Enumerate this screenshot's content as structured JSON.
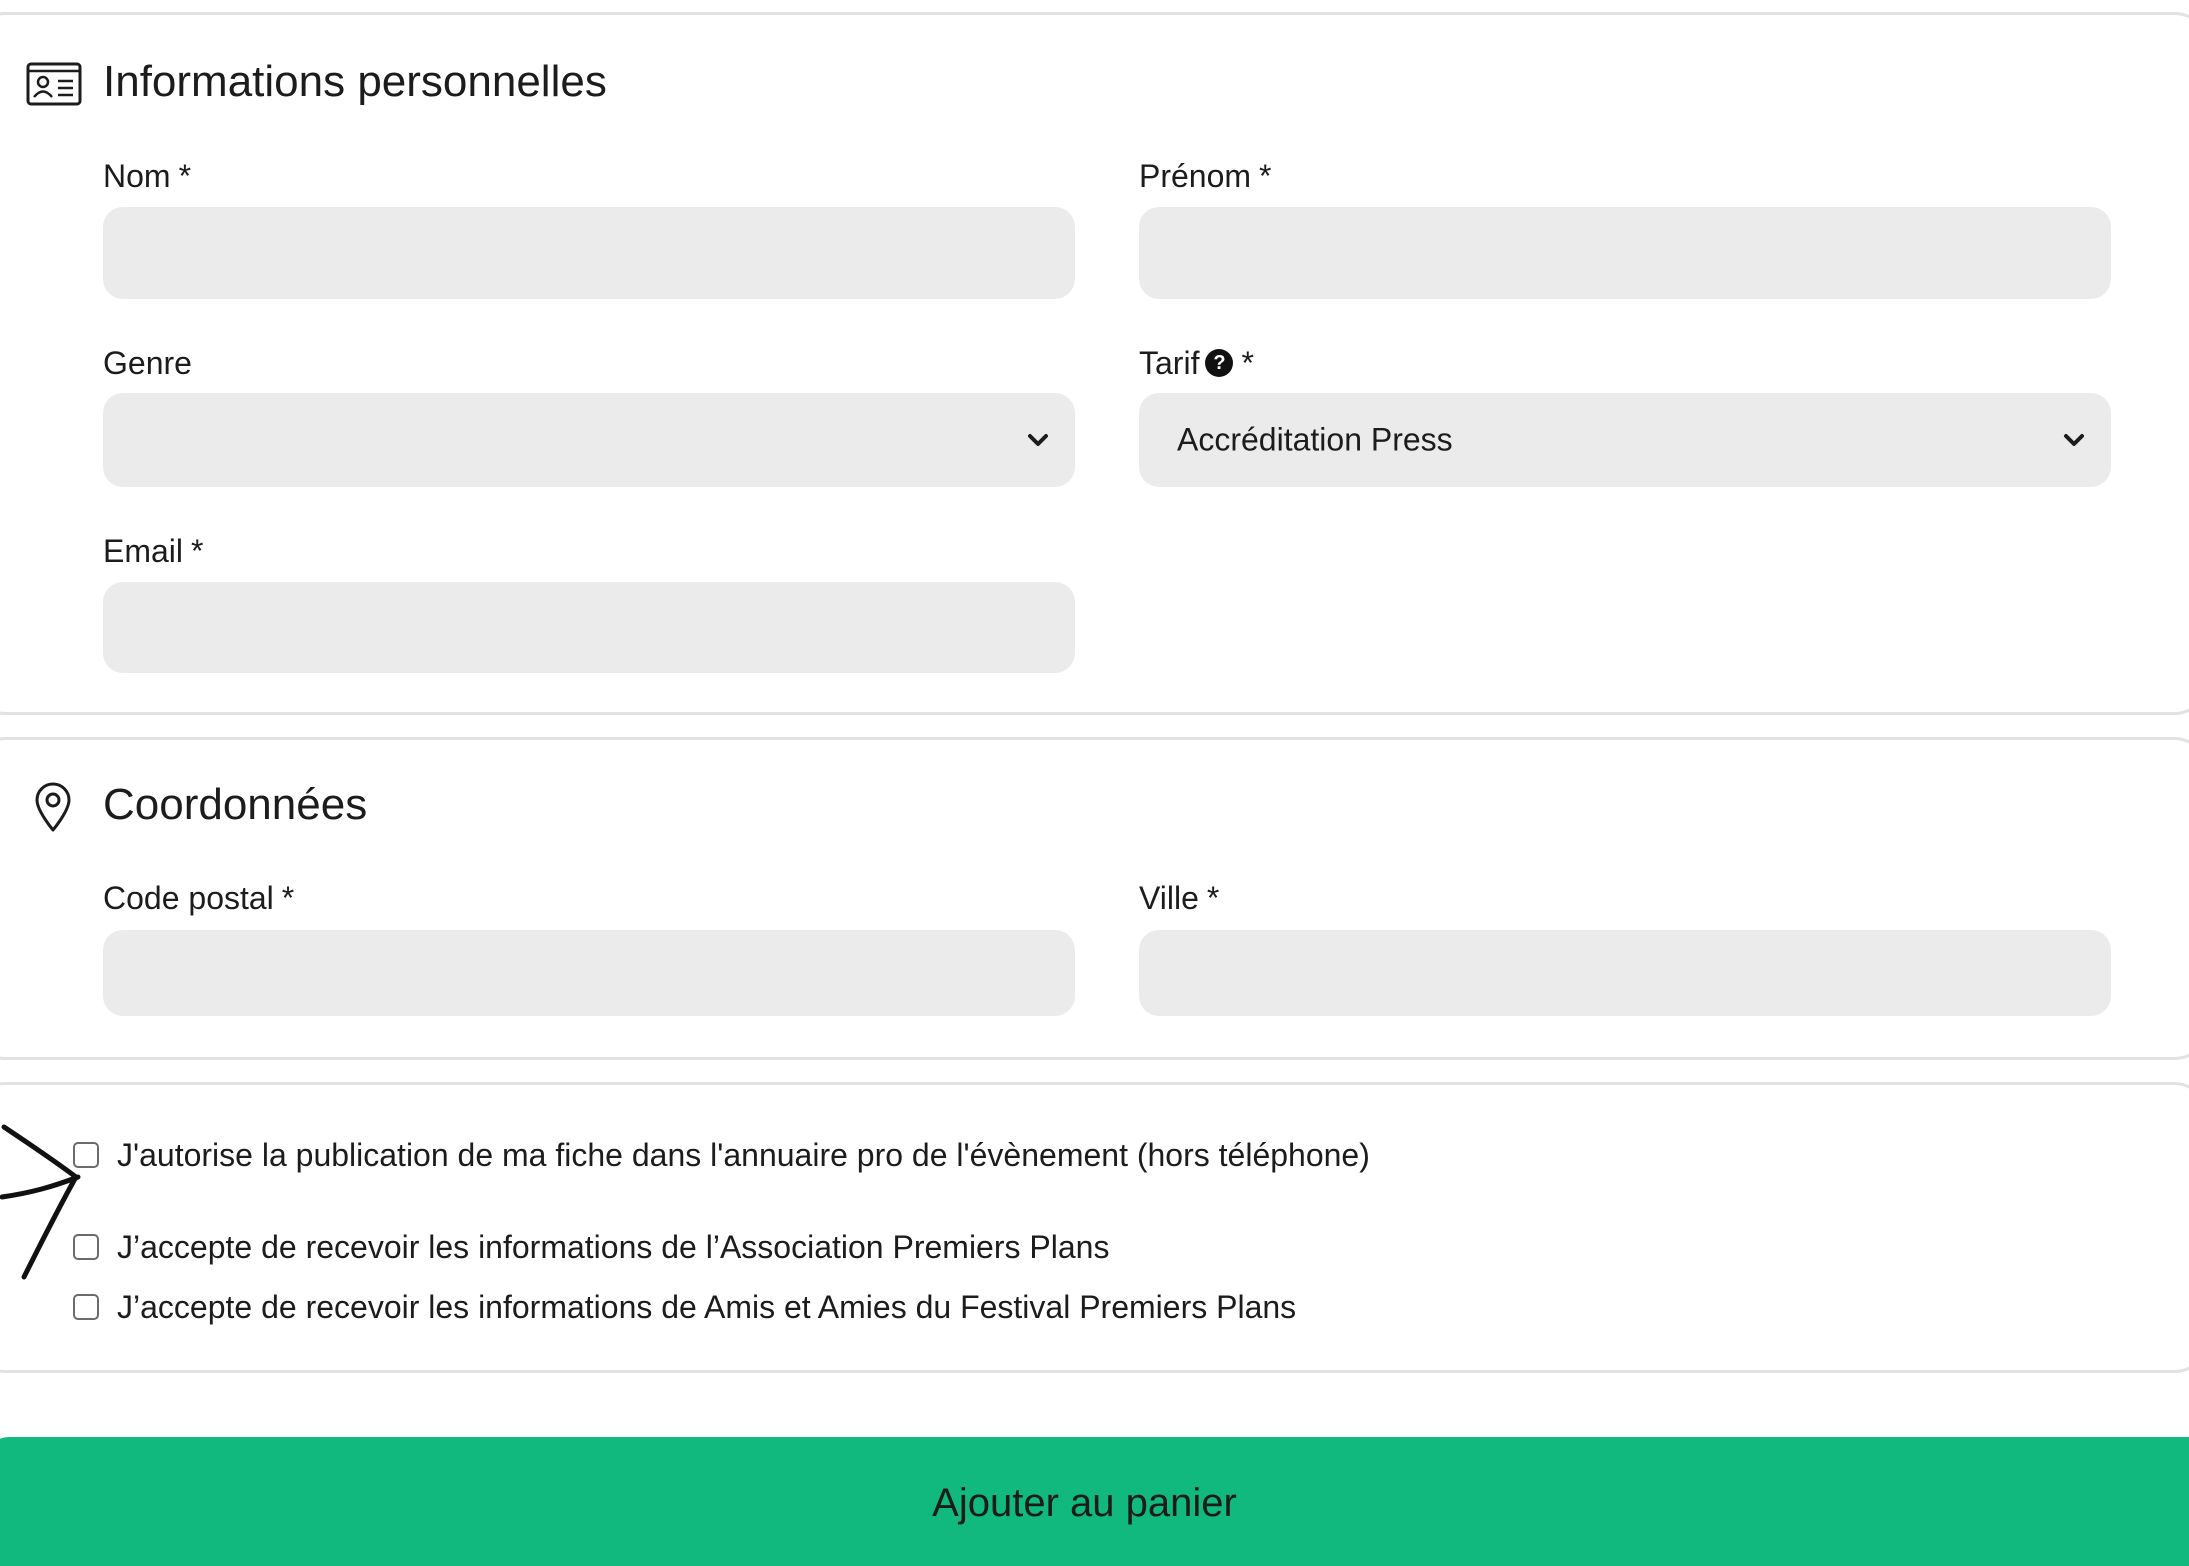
{
  "personal": {
    "title": "Informations personnelles",
    "icon": "id-card-icon",
    "nom_label": "Nom",
    "prenom_label": "Prénom",
    "genre_label": "Genre",
    "tarif_label": "Tarif",
    "tarif_value": "Accréditation Press",
    "email_label": "Email",
    "required_mark": "*",
    "help_glyph": "?"
  },
  "coords": {
    "title": "Coordonnées",
    "icon": "map-pin-icon",
    "code_postal_label": "Code postal",
    "ville_label": "Ville",
    "required_mark": "*"
  },
  "consent": {
    "items": [
      {
        "label": "J'autorise la publication de ma fiche dans l'annuaire pro de l'évènement (hors téléphone)",
        "checked": false
      },
      {
        "label": "J’accepte de recevoir les informations de l’Association Premiers Plans",
        "checked": false
      },
      {
        "label": "J’accepte de recevoir les informations de Amis et Amies du Festival Premiers Plans",
        "checked": false
      }
    ]
  },
  "submit": {
    "label": "Ajouter au panier"
  },
  "colors": {
    "accent": "#12b97f",
    "field_bg": "#ebebeb",
    "border": "#e2e2e2"
  }
}
